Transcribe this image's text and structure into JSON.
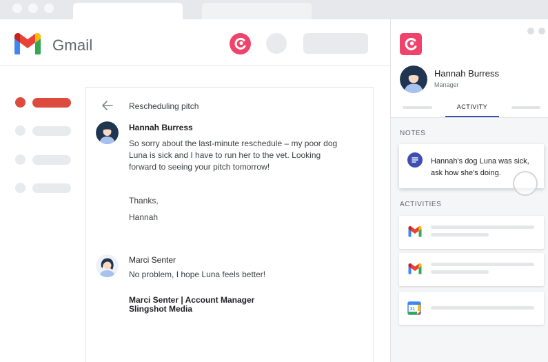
{
  "gmail": {
    "logo_text": "Gmail",
    "subject": "Rescheduling pitch",
    "messages": [
      {
        "sender": "Hannah Burress",
        "body": "So sorry about the last-minute reschedule – my poor dog Luna is sick and I have to run her to the vet. Looking forward to seeing your pitch tomorrow!",
        "closing": "Thanks,",
        "signoff": "Hannah"
      },
      {
        "sender": "Marci Senter",
        "body": "No problem, I hope Luna feels better!",
        "signature_line1": "Marci Senter | Account Manager",
        "signature_line2": "Slingshot Media"
      }
    ]
  },
  "panel": {
    "contact_name": "Hannah Burress",
    "contact_role": "Manager",
    "active_tab": "ACTIVITY",
    "notes_label": "NOTES",
    "note_text": "Hannah's dog Luna was sick, ask how she's doing.",
    "activities_label": "ACTIVITIES",
    "activities": [
      {
        "icon": "gmail-icon"
      },
      {
        "icon": "gmail-icon"
      },
      {
        "icon": "google-calendar-icon",
        "day": "31"
      }
    ]
  },
  "colors": {
    "copper_pink": "#f0436b",
    "accent_indigo": "#3e4fb4",
    "nav_active_red": "#dd4b3e",
    "placeholder_grey": "#e8eaed"
  }
}
